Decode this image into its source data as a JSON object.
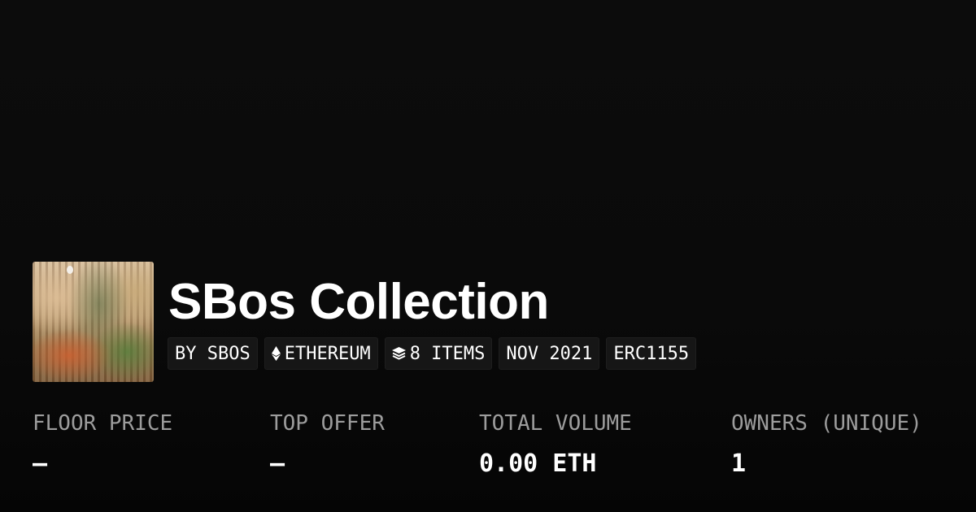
{
  "collection": {
    "title": "SBos Collection",
    "tags": {
      "creator": "BY SBOS",
      "chain": "ETHEREUM",
      "items": "8 ITEMS",
      "date": "NOV 2021",
      "standard": "ERC1155"
    },
    "tag_icons": {
      "chain": "ethereum-icon",
      "items": "layers-icon"
    }
  },
  "stats": {
    "floor_price": {
      "label": "FLOOR PRICE",
      "value": "—"
    },
    "top_offer": {
      "label": "TOP OFFER",
      "value": "—"
    },
    "total_volume": {
      "label": "TOTAL VOLUME",
      "value": "0.00 ETH"
    },
    "owners": {
      "label": "OWNERS (UNIQUE)",
      "value": "1"
    }
  },
  "colors": {
    "background": "#0a0a0a",
    "text": "#ffffff",
    "label": "#9c9c9c",
    "tag_background": "#161616"
  }
}
